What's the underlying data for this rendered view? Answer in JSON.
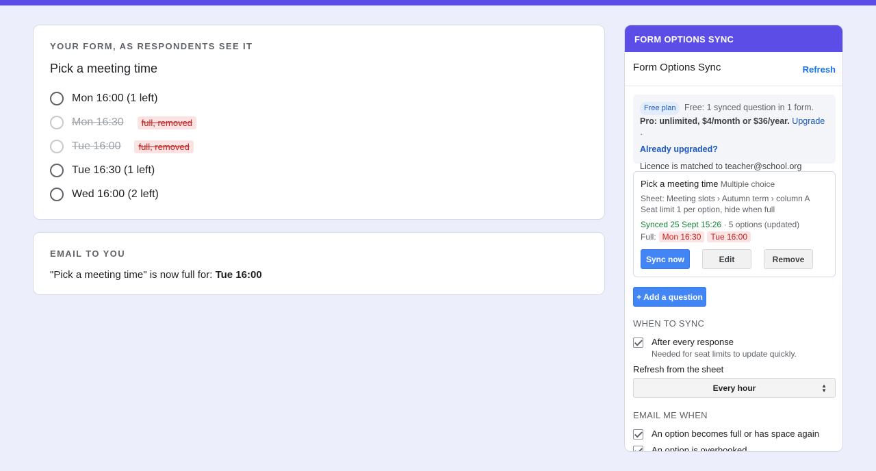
{
  "form_card": {
    "section_label": "YOUR FORM, AS RESPONDENTS SEE IT",
    "question_title": "Pick a meeting time",
    "options": [
      {
        "label": "Mon 16:00 (1 left)",
        "removed": false,
        "badge": ""
      },
      {
        "label": "Mon 16:30",
        "removed": true,
        "badge": "full, removed"
      },
      {
        "label": "Tue 16:00",
        "removed": true,
        "badge": "full, removed"
      },
      {
        "label": "Tue 16:30 (1 left)",
        "removed": false,
        "badge": ""
      },
      {
        "label": "Wed 16:00 (2 left)",
        "removed": false,
        "badge": ""
      }
    ]
  },
  "email_card": {
    "section_label": "EMAIL TO YOU",
    "message_prefix": "\"Pick a meeting time\" is now full for: ",
    "message_bold": "Tue 16:00"
  },
  "panel": {
    "header": "FORM OPTIONS SYNC",
    "title": "Form Options Sync",
    "refresh_label": "Refresh",
    "plan": {
      "pill": "Free plan",
      "free_text": "Free: 1 synced question in 1 form.",
      "pro_text": "Pro: unlimited, $4/month or $36/year.",
      "upgrade_link": "Upgrade",
      "separator": "·",
      "already_upgraded": "Already upgraded?",
      "licence": "Licence is matched to teacher@school.org"
    },
    "question": {
      "title": "Pick a meeting time",
      "type": "Multiple choice",
      "sheet": "Sheet: Meeting slots › Autumn term › column A",
      "limit": "Seat limit 1 per option, hide when full",
      "synced": "Synced 25 Sept 15:26",
      "options_info": "· 5 options (updated)",
      "full_label": "Full:",
      "full_options": [
        "Mon 16:30",
        "Tue 16:00"
      ],
      "sync_now": "Sync now",
      "edit": "Edit",
      "remove": "Remove"
    },
    "add_question": "+ Add a question",
    "when_to_sync": {
      "heading": "WHEN TO SYNC",
      "after_response_label": "After every response",
      "after_response_hint": "Needed for seat limits to update quickly.",
      "after_response_checked": true,
      "refresh_label": "Refresh from the sheet",
      "refresh_value": "Every hour"
    },
    "email_me": {
      "heading": "EMAIL ME WHEN",
      "items": [
        {
          "label": "An option becomes full or has space again",
          "checked": true
        },
        {
          "label": "An option is overbooked",
          "checked": true
        }
      ]
    }
  },
  "colors": {
    "accent": "#5b4de6",
    "button_blue": "#4285f4",
    "link_blue": "#1a73e8",
    "removed_red": "#c5221f",
    "removed_bg": "#fce3e3",
    "synced_green": "#188038"
  },
  "icons": [
    "radio-button",
    "checkbox-check-icon",
    "select-arrows-icon"
  ]
}
